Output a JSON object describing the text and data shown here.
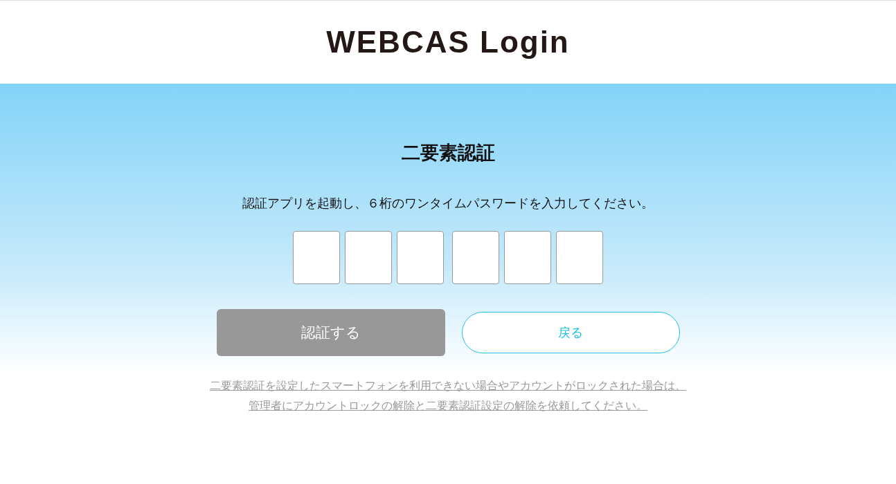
{
  "header": {
    "logo": "WEBCAS Login"
  },
  "title": "二要素認証",
  "instruction": "認証アプリを起動し、６桁のワンタイムパスワードを入力してください。",
  "code_field_groups": [
    {
      "fields": [
        {
          "kind": "digit"
        },
        {
          "kind": "digit"
        },
        {
          "kind": "digit"
        }
      ]
    },
    {
      "fields": [
        {
          "kind": "digit"
        },
        {
          "kind": "digit"
        },
        {
          "kind": "digit"
        }
      ]
    }
  ],
  "buttons": [
    {
      "kind": "submit",
      "label": "認証する",
      "disabled": true
    },
    {
      "kind": "back",
      "label": "戻る",
      "disabled": false
    }
  ],
  "help_link": {
    "lines": [
      "二要素認証を設定したスマートフォンを利用できない場合やアカウントがロックされた場合は、",
      "管理者にアカウントロックの解除と二要素認証設定の解除を依頼してください。"
    ]
  }
}
